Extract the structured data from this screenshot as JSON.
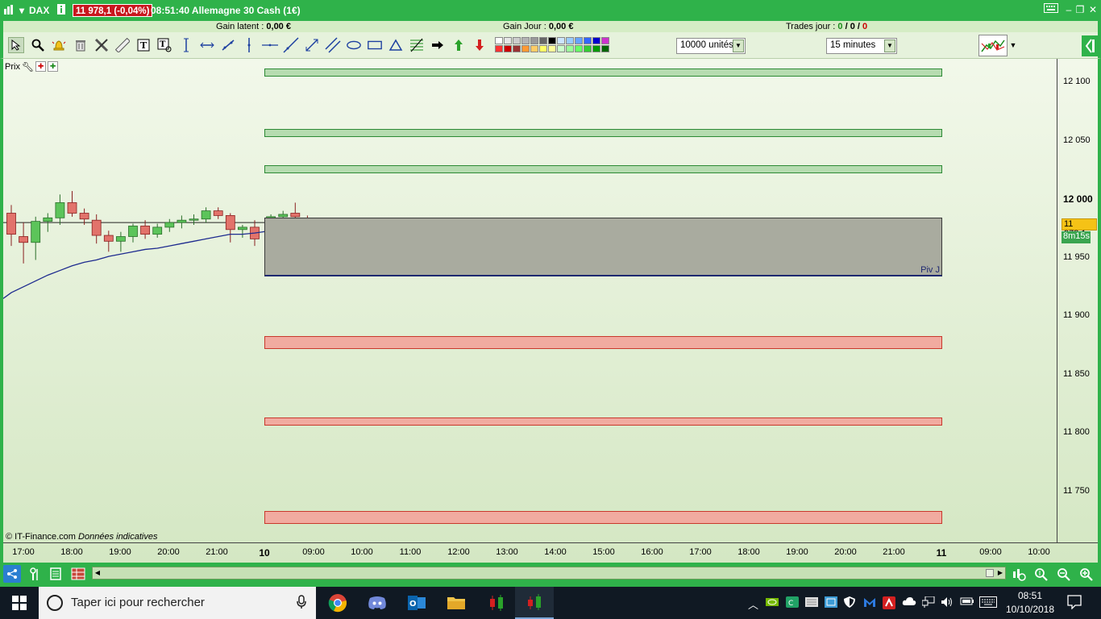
{
  "title_bar": {
    "app_label": "DAX",
    "price_badge": "11 978,1 (-0,04%)",
    "time_and_instrument": "08:51:40 Allemagne 30 Cash (1€)"
  },
  "info_bar": {
    "gain_latent_label": "Gain latent :",
    "gain_latent_value": "0,00 €",
    "gain_jour_label": "Gain Jour :",
    "gain_jour_value": "0,00 €",
    "trades_label": "Trades jour :",
    "trades_a": "0",
    "trades_b": "0",
    "trades_c": "0",
    "slash": "/"
  },
  "toolbar": {
    "units_combo": "10000 unités",
    "timeframe_combo": "15 minutes",
    "swatch_colors": [
      "#ffffff",
      "#e6e6e6",
      "#cccccc",
      "#b3b3b3",
      "#999999",
      "#666666",
      "#000000",
      "#cce5ff",
      "#99ccff",
      "#66a3ff",
      "#3366ff",
      "#0000cc",
      "#cc33cc",
      "#ff3333",
      "#cc0000",
      "#993333",
      "#ff9933",
      "#ffcc66",
      "#ffff66",
      "#ffff99",
      "#ccffcc",
      "#99ff99",
      "#66ff66",
      "#33cc33",
      "#009900",
      "#006600"
    ]
  },
  "chart": {
    "panel_label": "Prix",
    "y_ticks": [
      "12 100",
      "12 050",
      "12 000",
      "11 950",
      "11 900",
      "11 850",
      "11 800",
      "11 750"
    ],
    "last_price": "11 978,1",
    "countdown": "8m15s",
    "copyright": "© IT-Finance.com",
    "disclaimer": "Données indicatives",
    "pivot_label": "Piv J",
    "x_ticks": [
      "17:00",
      "18:00",
      "19:00",
      "20:00",
      "21:00",
      "10",
      "09:00",
      "10:00",
      "11:00",
      "12:00",
      "13:00",
      "14:00",
      "15:00",
      "16:00",
      "17:00",
      "18:00",
      "19:00",
      "20:00",
      "21:00",
      "11",
      "09:00",
      "10:00"
    ]
  },
  "chart_data": {
    "type": "candlestick",
    "ylim": [
      11715,
      12120
    ],
    "y_ticks": [
      12100,
      12050,
      12000,
      11950,
      11900,
      11850,
      11800,
      11750
    ],
    "categories": [
      "16:45",
      "17:00",
      "17:15",
      "17:30",
      "17:45",
      "18:00",
      "18:15",
      "18:30",
      "18:45",
      "19:00",
      "19:15",
      "19:30",
      "19:45",
      "20:00",
      "20:15",
      "20:30",
      "20:45",
      "21:00",
      "21:15",
      "21:30",
      "21:45",
      "08:00",
      "08:15",
      "08:30",
      "08:45"
    ],
    "candles": [
      {
        "o": 11988,
        "h": 11995,
        "l": 11960,
        "c": 11970,
        "up": false
      },
      {
        "o": 11968,
        "h": 11980,
        "l": 11945,
        "c": 11963,
        "up": false
      },
      {
        "o": 11963,
        "h": 11985,
        "l": 11948,
        "c": 11981,
        "up": true
      },
      {
        "o": 11981,
        "h": 11988,
        "l": 11972,
        "c": 11984,
        "up": true
      },
      {
        "o": 11984,
        "h": 12004,
        "l": 11978,
        "c": 11997,
        "up": true
      },
      {
        "o": 11997,
        "h": 12007,
        "l": 11985,
        "c": 11988,
        "up": false
      },
      {
        "o": 11988,
        "h": 11992,
        "l": 11978,
        "c": 11983,
        "up": false
      },
      {
        "o": 11982,
        "h": 11987,
        "l": 11962,
        "c": 11969,
        "up": false
      },
      {
        "o": 11969,
        "h": 11973,
        "l": 11955,
        "c": 11964,
        "up": false
      },
      {
        "o": 11964,
        "h": 11972,
        "l": 11955,
        "c": 11968,
        "up": true
      },
      {
        "o": 11968,
        "h": 11979,
        "l": 11963,
        "c": 11977,
        "up": true
      },
      {
        "o": 11977,
        "h": 11982,
        "l": 11966,
        "c": 11970,
        "up": false
      },
      {
        "o": 11970,
        "h": 11979,
        "l": 11967,
        "c": 11976,
        "up": true
      },
      {
        "o": 11976,
        "h": 11983,
        "l": 11972,
        "c": 11980,
        "up": true
      },
      {
        "o": 11980,
        "h": 11986,
        "l": 11975,
        "c": 11982,
        "up": true
      },
      {
        "o": 11982,
        "h": 11987,
        "l": 11978,
        "c": 11983,
        "up": true
      },
      {
        "o": 11983,
        "h": 11993,
        "l": 11980,
        "c": 11990,
        "up": true
      },
      {
        "o": 11990,
        "h": 11993,
        "l": 11983,
        "c": 11986,
        "up": false
      },
      {
        "o": 11986,
        "h": 11988,
        "l": 11963,
        "c": 11974,
        "up": false
      },
      {
        "o": 11974,
        "h": 11978,
        "l": 11967,
        "c": 11976,
        "up": true
      },
      {
        "o": 11976,
        "h": 11982,
        "l": 11960,
        "c": 11966,
        "up": false
      },
      {
        "o": 11962,
        "h": 11987,
        "l": 11960,
        "c": 11985,
        "up": true
      },
      {
        "o": 11985,
        "h": 11990,
        "l": 11982,
        "c": 11987,
        "up": true
      },
      {
        "o": 11988,
        "h": 11997,
        "l": 11980,
        "c": 11985,
        "up": false
      },
      {
        "o": 11983,
        "h": 11986,
        "l": 11975,
        "c": 11978,
        "up": false
      }
    ],
    "moving_average": [
      11920,
      11925,
      11930,
      11935,
      11939,
      11943,
      11946,
      11948,
      11951,
      11953,
      11955,
      11957,
      11958,
      11960,
      11962,
      11964,
      11966,
      11968,
      11970,
      11970,
      11971,
      11973,
      11974,
      11975,
      11976
    ],
    "reference_line": 11980,
    "zones": [
      {
        "kind": "green",
        "top": 12112,
        "bottom": 12105
      },
      {
        "kind": "green",
        "top": 12060,
        "bottom": 12053
      },
      {
        "kind": "green",
        "top": 12029,
        "bottom": 12022
      },
      {
        "kind": "pivot",
        "top": 11984,
        "bottom": 11934,
        "label": "Piv J"
      },
      {
        "kind": "red",
        "top": 11883,
        "bottom": 11872
      },
      {
        "kind": "red",
        "top": 11813,
        "bottom": 11806
      },
      {
        "kind": "red",
        "top": 11733,
        "bottom": 11722
      }
    ]
  },
  "bottom_bar": {
    "icons": [
      "share-icon",
      "tools-icon",
      "calculator-icon",
      "grid-icon",
      "new-order-icon",
      "zoom-fit-icon",
      "zoom-out-icon",
      "zoom-in-icon"
    ]
  },
  "taskbar": {
    "search_placeholder": "Taper ici pour rechercher",
    "time": "08:51",
    "date": "10/10/2018"
  }
}
